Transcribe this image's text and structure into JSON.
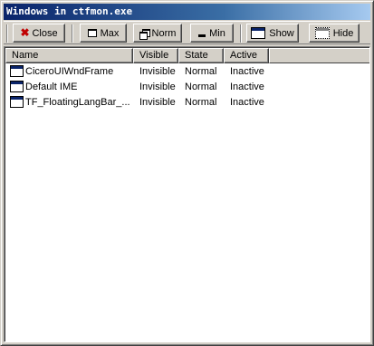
{
  "window": {
    "title": "Windows in ctfmon.exe"
  },
  "toolbar": {
    "close_label": "Close",
    "max_label": "Max",
    "norm_label": "Norm",
    "min_label": "Min",
    "show_label": "Show",
    "hide_label": "Hide"
  },
  "table": {
    "columns": [
      "Name",
      "Visible",
      "State",
      "Active"
    ],
    "rows": [
      {
        "name": "CiceroUIWndFrame",
        "visible": "Invisible",
        "state": "Normal",
        "active": "Inactive",
        "icon": "window-icon"
      },
      {
        "name": "Default IME",
        "visible": "Invisible",
        "state": "Normal",
        "active": "Inactive",
        "icon": "window-icon"
      },
      {
        "name": "TF_FloatingLangBar_...",
        "visible": "Invisible",
        "state": "Normal",
        "active": "Inactive",
        "icon": "window-icon"
      }
    ]
  }
}
